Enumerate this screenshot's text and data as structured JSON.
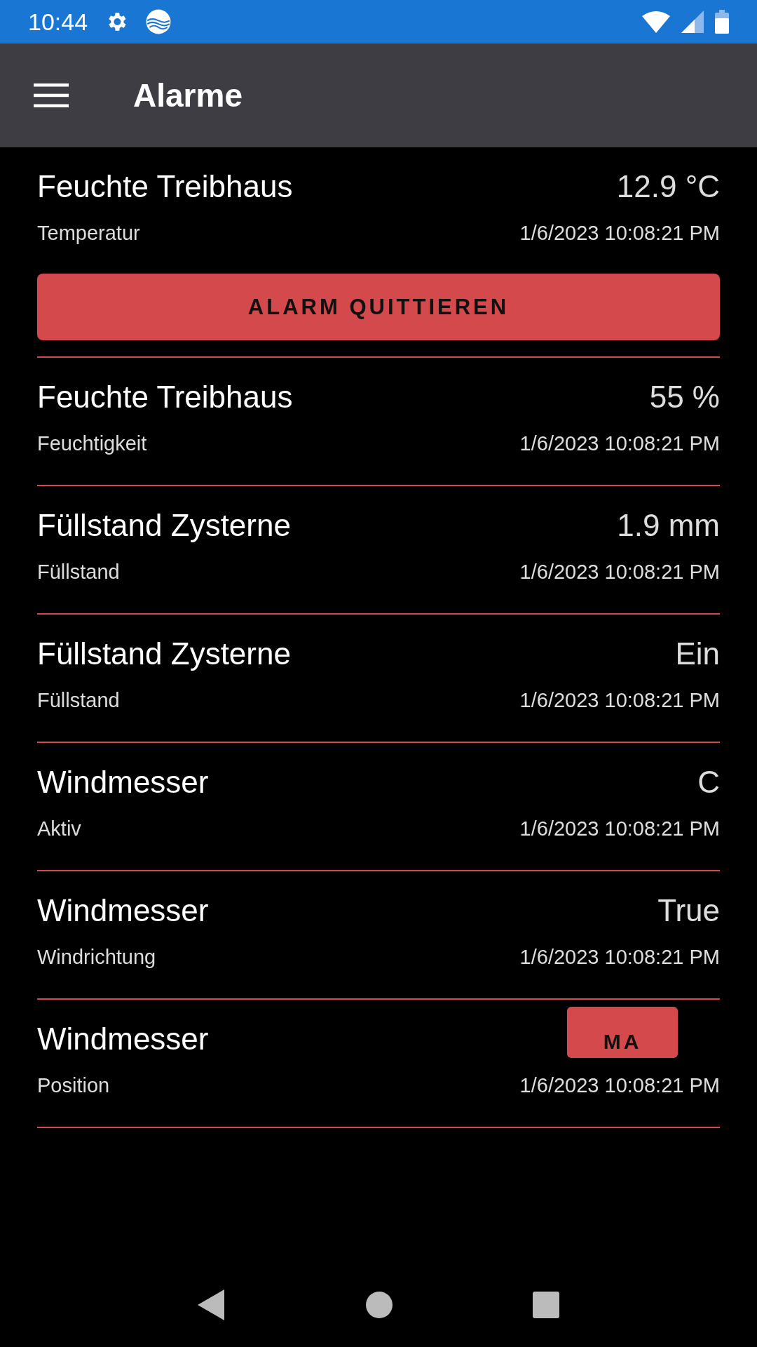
{
  "status_bar": {
    "time": "10:44"
  },
  "app_bar": {
    "title": "Alarme"
  },
  "alarms": [
    {
      "name": "Feuchte Treibhaus",
      "value": "12.9 °C",
      "type": "Temperatur",
      "timestamp": "1/6/2023 10:08:21 PM",
      "action": "ALARM QUITTIEREN"
    },
    {
      "name": "Feuchte Treibhaus",
      "value": "55 %",
      "type": "Feuchtigkeit",
      "timestamp": "1/6/2023 10:08:21 PM"
    },
    {
      "name": "Füllstand Zysterne",
      "value": "1.9 mm",
      "type": "Füllstand",
      "timestamp": "1/6/2023 10:08:21 PM"
    },
    {
      "name": "Füllstand Zysterne",
      "value": "Ein",
      "type": "Füllstand",
      "timestamp": "1/6/2023 10:08:21 PM"
    },
    {
      "name": "Windmesser",
      "value": "C",
      "type": "Aktiv",
      "timestamp": "1/6/2023 10:08:21 PM"
    },
    {
      "name": "Windmesser",
      "value": "True",
      "type": "Windrichtung",
      "timestamp": "1/6/2023 10:08:21 PM"
    },
    {
      "name": "Windmesser",
      "type": "Position",
      "timestamp": "1/6/2023 10:08:21 PM",
      "overlay_button": "MA"
    }
  ]
}
